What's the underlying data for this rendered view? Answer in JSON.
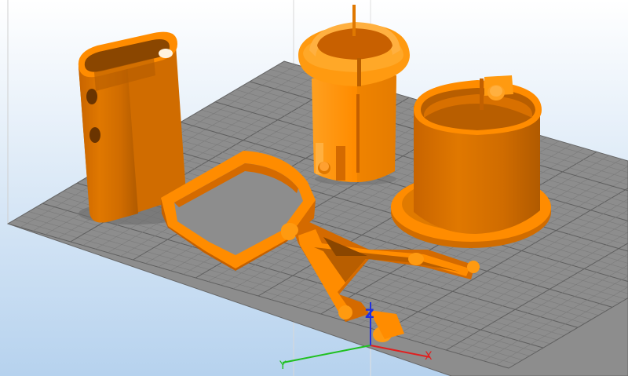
{
  "viewport": {
    "background_top": "#ffffff",
    "background_bottom": "#b6d2ee"
  },
  "bed": {
    "plate_color": "#8d8d8d",
    "grid_minor_color": "#7b7b7b",
    "grid_major_color": "#5f5f5f"
  },
  "model": {
    "color_main": "#ff8c00",
    "color_shade": "#d46a00",
    "color_dark": "#a85400",
    "color_highlight": "#ffb040",
    "parts": [
      "oval-sleeve",
      "slotted-collet",
      "flanged-cup",
      "loop-clamp",
      "fork-arm"
    ]
  },
  "axes": {
    "x_label": "X",
    "y_label": "Y",
    "z_label": "Z",
    "x_color": "#e02020",
    "y_color": "#20c020",
    "z_color": "#2030e0"
  }
}
